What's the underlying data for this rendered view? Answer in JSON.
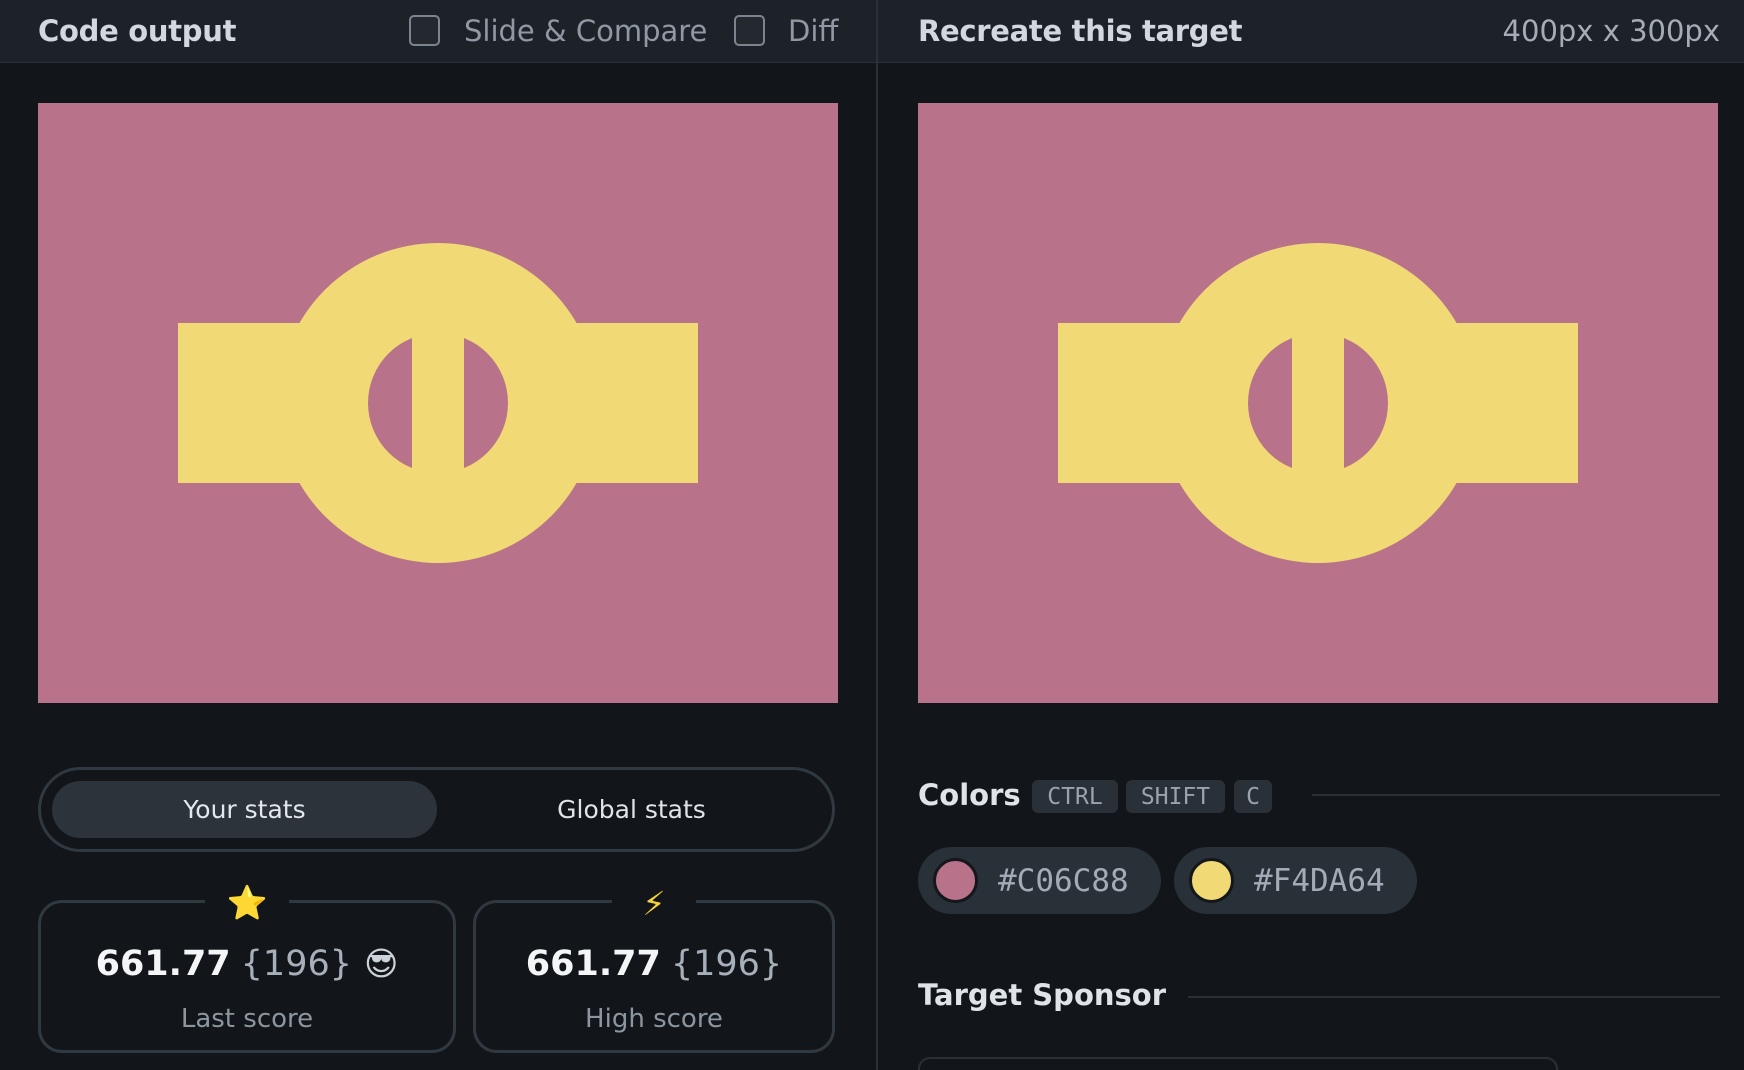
{
  "left_header": {
    "title": "Code output",
    "option_slide": "Slide & Compare",
    "option_diff": "Diff"
  },
  "right_header": {
    "title": "Recreate this target",
    "dimensions": "400px x 300px"
  },
  "stats": {
    "tab_active": "Your stats",
    "tab_inactive": "Global stats",
    "last": {
      "icon": "star-icon",
      "glyph": "⭐",
      "value": "661.77",
      "count": "{196}",
      "emoji": "😎",
      "label": "Last score"
    },
    "high": {
      "icon": "lightning-icon",
      "glyph": "⚡",
      "value": "661.77",
      "count": "{196}",
      "label": "High score"
    }
  },
  "colors_section": {
    "title": "Colors",
    "shortcut": [
      "CTRL",
      "SHIFT",
      "C"
    ],
    "swatches": [
      {
        "hex": "#C06C88",
        "color": "#b87289"
      },
      {
        "hex": "#F4DA64",
        "color": "#f1da76"
      }
    ]
  },
  "sponsor_section": {
    "title": "Target Sponsor"
  },
  "palette": {
    "background": "#b87289",
    "shape": "#f1da76"
  }
}
